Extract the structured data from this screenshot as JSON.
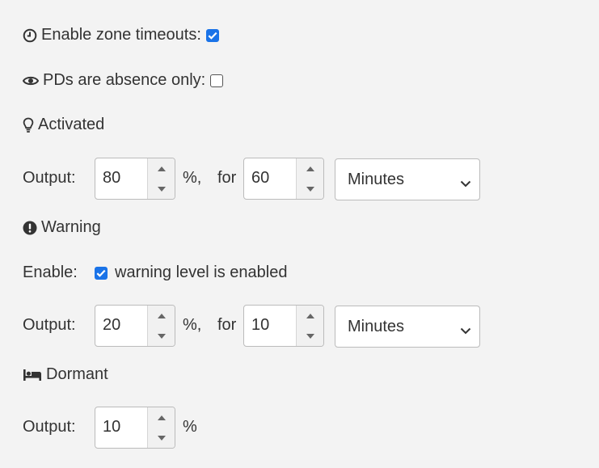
{
  "zone_timeouts": {
    "label": "Enable zone timeouts:",
    "checked": true
  },
  "pds_absence": {
    "label": "PDs are absence only:",
    "checked": false
  },
  "activated": {
    "title": "Activated",
    "output_label": "Output:",
    "output_value": "80",
    "percent_sep": "%,",
    "for_label": "for",
    "duration_value": "60",
    "unit": "Minutes"
  },
  "warning": {
    "title": "Warning",
    "enable_label": "Enable:",
    "enable_text": "warning level is enabled",
    "enabled": true,
    "output_label": "Output:",
    "output_value": "20",
    "percent_sep": "%,",
    "for_label": "for",
    "duration_value": "10",
    "unit": "Minutes"
  },
  "dormant": {
    "title": "Dormant",
    "output_label": "Output:",
    "output_value": "10",
    "percent": "%"
  },
  "icons": {
    "zone_timeouts": "clock-icon",
    "pds_absence": "eye-icon",
    "activated": "lightbulb-icon",
    "warning": "exclamation-circle-icon",
    "dormant": "bed-icon"
  },
  "colors": {
    "checkbox_accent": "#1a73e8",
    "text": "#333333",
    "background": "#f3f3f3"
  }
}
